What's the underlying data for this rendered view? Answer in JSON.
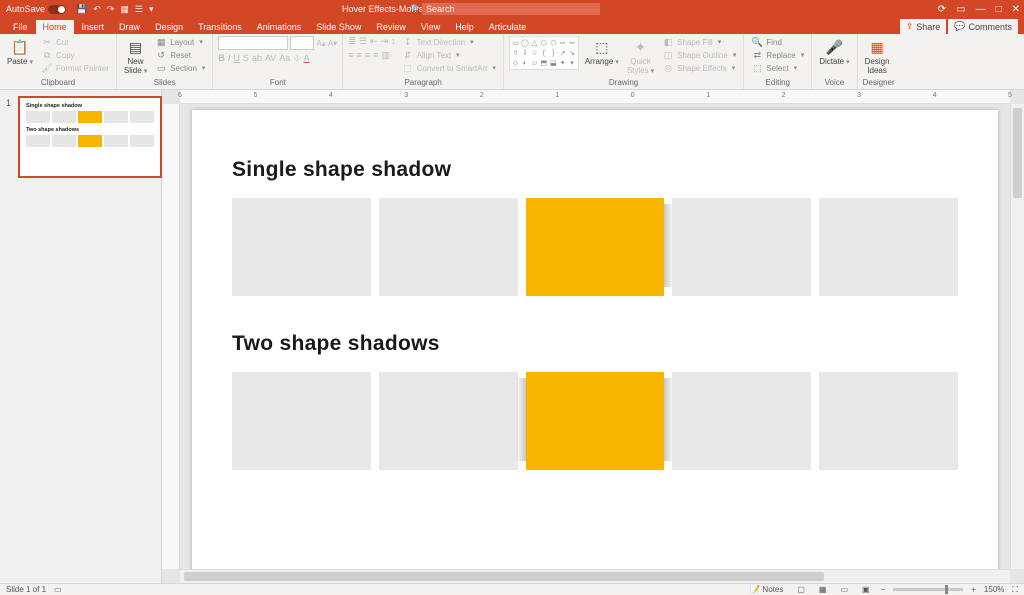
{
  "titlebar": {
    "autosave_label": "AutoSave",
    "doc_title": "Hover Effects-MontseAnderson ▾",
    "search_placeholder": "Search"
  },
  "tabs": {
    "file": "File",
    "home": "Home",
    "insert": "Insert",
    "draw": "Draw",
    "design": "Design",
    "transitions": "Transitions",
    "animations": "Animations",
    "slideshow": "Slide Show",
    "review": "Review",
    "view": "View",
    "help": "Help",
    "articulate": "Articulate",
    "share": "Share",
    "comments": "Comments"
  },
  "ribbon": {
    "clipboard": {
      "label": "Clipboard",
      "paste": "Paste",
      "cut": "Cut",
      "copy": "Copy",
      "fp": "Format Painter"
    },
    "slides": {
      "label": "Slides",
      "newslide": "New\nSlide",
      "layout": "Layout",
      "reset": "Reset",
      "section": "Section"
    },
    "font": {
      "label": "Font"
    },
    "paragraph": {
      "label": "Paragraph",
      "textdir": "Text Direction",
      "align": "Align Text",
      "smartart": "Convert to SmartArt"
    },
    "drawing": {
      "label": "Drawing",
      "arrange": "Arrange",
      "quick": "Quick\nStyles",
      "fill": "Shape Fill",
      "outline": "Shape Outline",
      "effects": "Shape Effects"
    },
    "editing": {
      "label": "Editing",
      "find": "Find",
      "replace": "Replace",
      "select": "Select"
    },
    "voice": {
      "label": "Voice",
      "dictate": "Dictate"
    },
    "designer": {
      "label": "Designer",
      "ideas": "Design\nIdeas"
    }
  },
  "thumb": {
    "num": "1",
    "t1": "Single shape shadow",
    "t2": "Two shape shadows"
  },
  "slide": {
    "h1": "Single shape shadow",
    "h2": "Two shape shadows"
  },
  "status": {
    "left": "Slide 1 of 1",
    "notes": "Notes",
    "zoom": "150%"
  },
  "ruler_ticks": [
    "6",
    "5",
    "4",
    "3",
    "2",
    "1",
    "0",
    "1",
    "2",
    "3",
    "4",
    "5"
  ]
}
